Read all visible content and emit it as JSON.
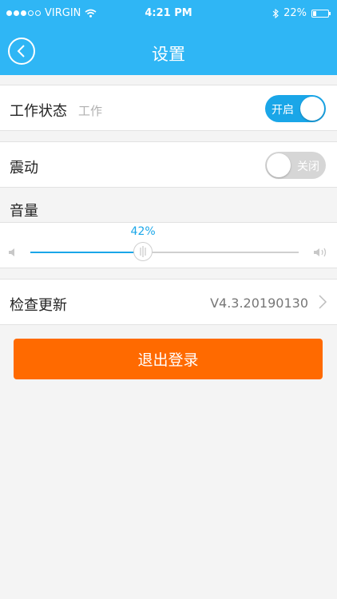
{
  "status_bar": {
    "carrier": "VIRGIN",
    "time": "4:21 PM",
    "battery": "22%",
    "battery_level": 0.22,
    "signal_bars": 3
  },
  "header": {
    "title": "设置"
  },
  "rows": {
    "work_status": {
      "label": "工作状态",
      "sub": "工作",
      "toggle_label": "开启",
      "on": true
    },
    "vibration": {
      "label": "震动",
      "toggle_label": "关闭",
      "on": false
    }
  },
  "volume": {
    "label": "音量",
    "value_text": "42%",
    "value": 0.42
  },
  "update": {
    "label": "检查更新",
    "version": "V4.3.20190130"
  },
  "logout": {
    "label": "退出登录"
  },
  "colors": {
    "header_bg": "#2fb6f5",
    "accent": "#1aa6e8",
    "logout_bg": "#ff6a00"
  }
}
